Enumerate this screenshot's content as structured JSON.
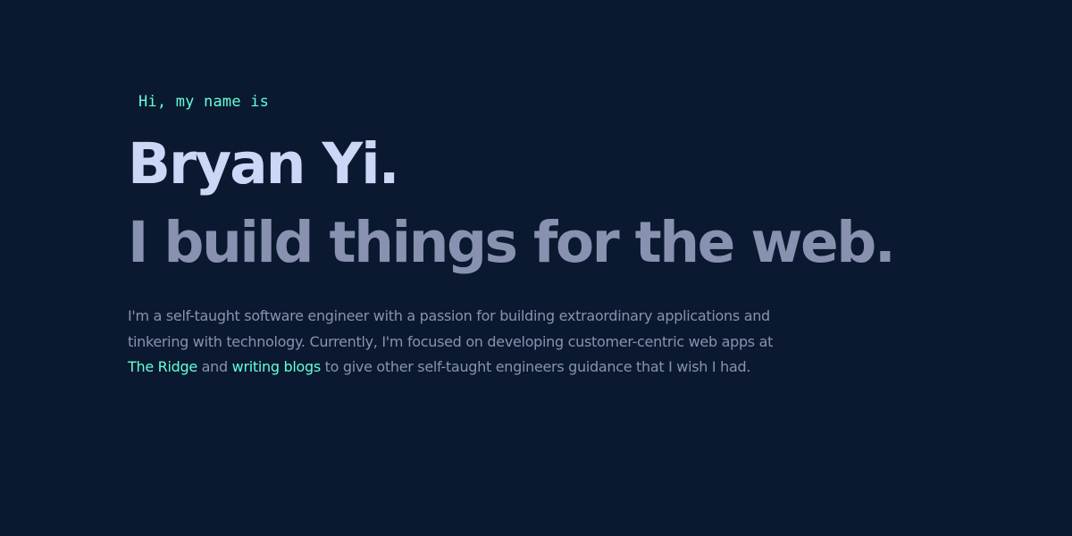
{
  "hero": {
    "intro": "Hi, my name is",
    "name": "Bryan Yi.",
    "tagline": "I build things for the web.",
    "bio": {
      "part1": "I'm a self-taught software engineer with a passion for building extraordinary applications and tinkering with technology. Currently, I'm focused on developing customer-centric web apps at ",
      "link1": "The Ridge",
      "part2": " and ",
      "link2": "writing blogs",
      "part3": " to give other self-taught engineers guidance that I wish I had."
    }
  },
  "colors": {
    "background": "#0a192f",
    "accent": "#64ffda",
    "heading": "#ccd6f6",
    "muted": "#8892b0"
  }
}
